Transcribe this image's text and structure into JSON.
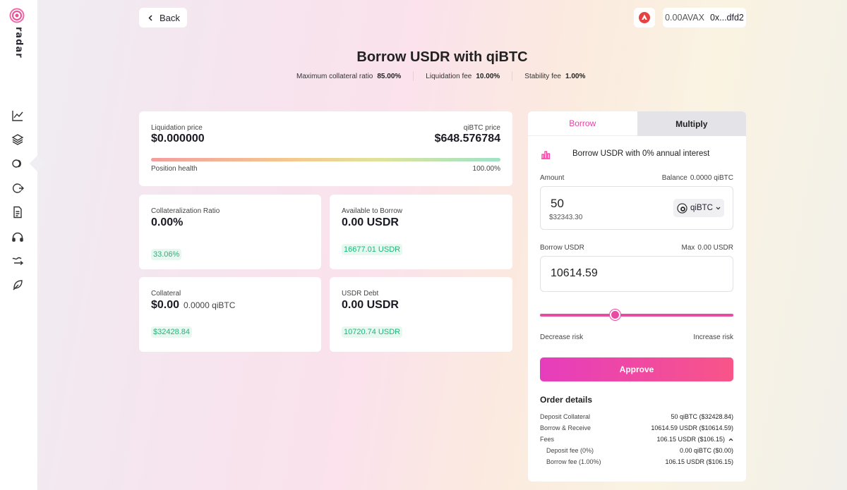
{
  "sidebar": {
    "brand": "radar",
    "items": [
      {
        "icon": "chart-line-icon"
      },
      {
        "icon": "layers-icon"
      },
      {
        "icon": "coins-icon"
      },
      {
        "icon": "exchange-icon"
      },
      {
        "icon": "document-icon"
      },
      {
        "icon": "headphones-icon"
      },
      {
        "icon": "swap-arrows-icon"
      },
      {
        "icon": "leaf-icon"
      }
    ]
  },
  "topbar": {
    "back_label": "Back",
    "avax_balance": "0.00AVAX",
    "wallet_address": "0x...dfd2"
  },
  "header": {
    "title": "Borrow USDR with qiBTC",
    "stats": [
      {
        "label": "Maximum collateral ratio",
        "value": "85.00%"
      },
      {
        "label": "Liquidation fee",
        "value": "10.00%"
      },
      {
        "label": "Stability fee",
        "value": "1.00%"
      }
    ]
  },
  "position": {
    "liquidation_price_label": "Liquidation price",
    "liquidation_price": "$0.000000",
    "asset_price_label": "qiBTC price",
    "asset_price": "$648.576784",
    "health_label": "Position health",
    "health_value": "100.00%"
  },
  "cards": {
    "collat_ratio": {
      "label": "Collateralization Ratio",
      "value": "0.00%",
      "pill": "33.06%"
    },
    "available": {
      "label": "Available to Borrow",
      "value": "0.00 USDR",
      "pill": "16677.01 USDR"
    },
    "collateral": {
      "label": "Collateral",
      "value": "$0.00",
      "sub": "0.0000 qiBTC",
      "pill": "$32428.84"
    },
    "debt": {
      "label": "USDR Debt",
      "value": "0.00 USDR",
      "pill": "10720.74 USDR"
    }
  },
  "panel": {
    "tabs": [
      "Borrow",
      "Multiply"
    ],
    "intro": "Borrow USDR with 0% annual interest",
    "amount_label": "Amount",
    "balance_label": "Balance",
    "balance_value": "0.0000 qiBTC",
    "amount_value": "50",
    "amount_usd": "$32343.30",
    "token": "qiBTC",
    "borrow_label": "Borrow USDR",
    "max_label": "Max",
    "max_value": "0.00 USDR",
    "borrow_value": "10614.59",
    "slider_level": 0.39,
    "decrease_label": "Decrease risk",
    "increase_label": "Increase risk",
    "approve_label": "Approve",
    "order_title": "Order details",
    "order_rows": [
      {
        "label": "Deposit Collateral",
        "value": "50 qiBTC ($32428.84)"
      },
      {
        "label": "Borrow & Receive",
        "value": "10614.59 USDR ($10614.59)"
      },
      {
        "label": "Fees",
        "value": "106.15 USDR ($106.15)"
      },
      {
        "label": "Deposit fee (0%)",
        "value": "0.00 qiBTC ($0.00)"
      },
      {
        "label": "Borrow fee (1.00%)",
        "value": "106.15 USDR ($106.15)"
      }
    ]
  },
  "colors": {
    "accent": "#ec3fa0",
    "green": "#1fb77a"
  }
}
